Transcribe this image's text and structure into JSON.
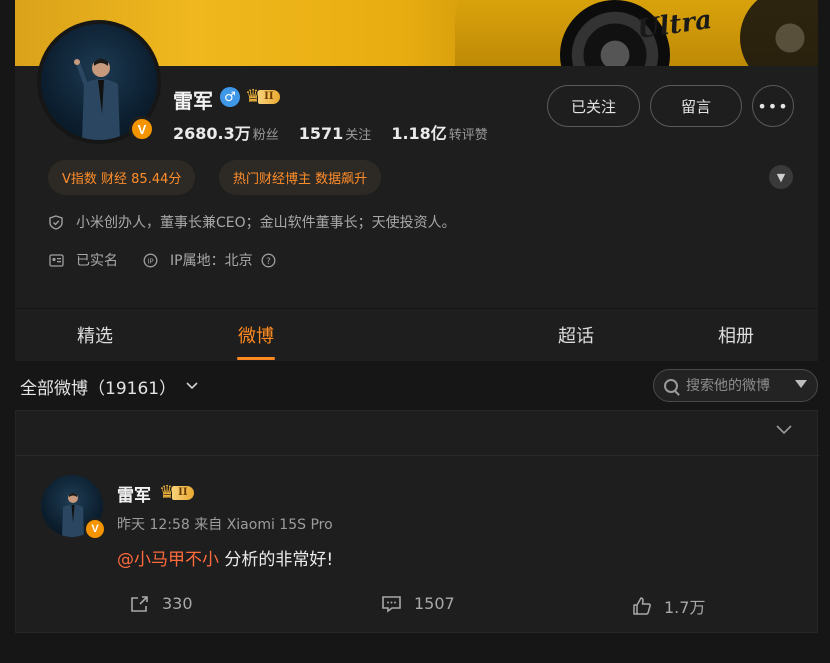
{
  "profile": {
    "name": "雷军",
    "vip_level": "II",
    "stats": [
      {
        "value": "2680.3万",
        "label": "粉丝"
      },
      {
        "value": "1571",
        "label": "关注"
      },
      {
        "value": "1.18亿",
        "label": "转评赞"
      }
    ],
    "actions": {
      "follow": "已关注",
      "message": "留言",
      "more": "•••"
    },
    "tags": [
      "V指数 财经 85.44分",
      "热门财经博主 数据飙升"
    ],
    "bio": "小米创办人，董事长兼CEO；金山软件董事长；天使投资人。",
    "verified_label": "已实名",
    "ip_location": "IP属地：北京"
  },
  "cover": {
    "car_text": "Ultra"
  },
  "tabs": [
    {
      "label": "精选",
      "active": false
    },
    {
      "label": "微博",
      "active": true
    },
    {
      "label": "超话",
      "active": false
    },
    {
      "label": "相册",
      "active": false
    }
  ],
  "filter": {
    "label": "全部微博（19161）"
  },
  "search": {
    "placeholder": "搜索他的微博"
  },
  "post": {
    "author": "雷军",
    "vip_level": "II",
    "meta": "昨天 12:58 来自 Xiaomi 15S Pro",
    "mention": "@小马甲不小",
    "text": " 分析的非常好!",
    "reposts": "330",
    "comments": "1507",
    "likes": "1.7万"
  },
  "colors": {
    "accent": "#ff8a1f",
    "background": "#161616",
    "card": "#1e1e1e",
    "mention": "#ff6a3c",
    "vbadge": "#f39400"
  }
}
